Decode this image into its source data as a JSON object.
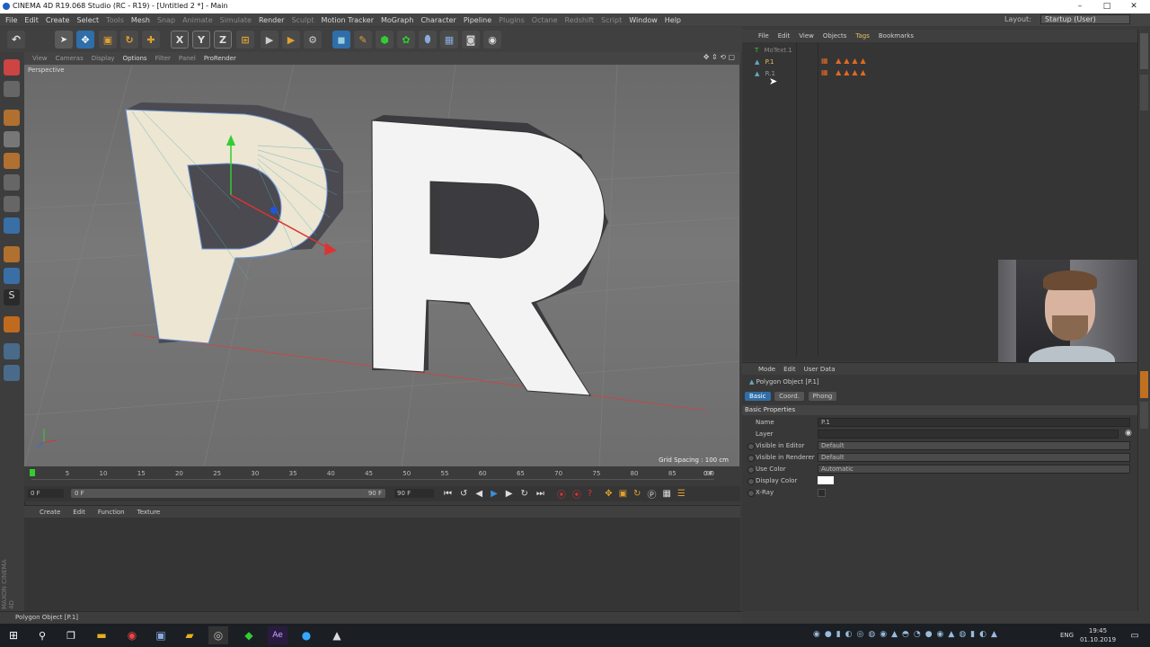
{
  "window": {
    "title": "CINEMA 4D R19.068 Studio (RC - R19) - [Untitled 2 *] - Main",
    "controls": [
      "–",
      "□",
      "✕"
    ]
  },
  "menubar": {
    "items": [
      {
        "label": "File",
        "dim": false
      },
      {
        "label": "Edit",
        "dim": false
      },
      {
        "label": "Create",
        "dim": false
      },
      {
        "label": "Select",
        "dim": false
      },
      {
        "label": "Tools",
        "dim": true
      },
      {
        "label": "Mesh",
        "dim": false
      },
      {
        "label": "Snap",
        "dim": true
      },
      {
        "label": "Animate",
        "dim": true
      },
      {
        "label": "Simulate",
        "dim": true
      },
      {
        "label": "Render",
        "dim": false
      },
      {
        "label": "Sculpt",
        "dim": true
      },
      {
        "label": "Motion Tracker",
        "dim": false
      },
      {
        "label": "MoGraph",
        "dim": false
      },
      {
        "label": "Character",
        "dim": false
      },
      {
        "label": "Pipeline",
        "dim": false
      },
      {
        "label": "Plugins",
        "dim": true
      },
      {
        "label": "Octane",
        "dim": true
      },
      {
        "label": "Redshift",
        "dim": true
      },
      {
        "label": "Script",
        "dim": true
      },
      {
        "label": "Window",
        "dim": false
      },
      {
        "label": "Help",
        "dim": false
      }
    ],
    "layout_label": "Layout:",
    "layout_value": "Startup (User)"
  },
  "toolbar": {
    "axis_x": "X",
    "axis_y": "Y",
    "axis_z": "Z"
  },
  "viewport": {
    "menu": [
      {
        "label": "View",
        "on": false
      },
      {
        "label": "Cameras",
        "on": false
      },
      {
        "label": "Display",
        "on": false
      },
      {
        "label": "Options",
        "on": true
      },
      {
        "label": "Filter",
        "on": false
      },
      {
        "label": "Panel",
        "on": false
      },
      {
        "label": "ProRender",
        "on": true
      }
    ],
    "camera_label": "Perspective",
    "grid_spacing": "Grid Spacing : 100 cm",
    "letter_left": "P",
    "letter_right": "R"
  },
  "timeline": {
    "ticks": [
      "0",
      "5",
      "10",
      "15",
      "20",
      "25",
      "30",
      "35",
      "40",
      "45",
      "50",
      "55",
      "60",
      "65",
      "70",
      "75",
      "80",
      "85",
      "90"
    ],
    "end_frame": "0 F",
    "start_field": "0 F",
    "min_field": "0 F",
    "max_field": "90 F",
    "end_field": "90 F"
  },
  "material": {
    "menu": [
      "Create",
      "Edit",
      "Function",
      "Texture"
    ]
  },
  "object_manager": {
    "menu": [
      "File",
      "Edit",
      "View",
      "Objects",
      "Tags",
      "Bookmarks"
    ],
    "objects": [
      {
        "name": "MoText.1"
      },
      {
        "name": "P.1"
      },
      {
        "name": "R.1"
      }
    ]
  },
  "attribute_manager": {
    "menu": [
      "Mode",
      "Edit",
      "User Data"
    ],
    "object_title": "Polygon Object [P.1]",
    "tabs": [
      "Basic",
      "Coord.",
      "Phong"
    ],
    "section": "Basic Properties",
    "properties": [
      {
        "label": "Name",
        "value": "P.1"
      },
      {
        "label": "Layer",
        "value": ""
      },
      {
        "label": "Visible in Editor",
        "value": "Default"
      },
      {
        "label": "Visible in Renderer",
        "value": "Default"
      },
      {
        "label": "Use Color",
        "value": "Automatic"
      },
      {
        "label": "Display Color",
        "value": ""
      },
      {
        "label": "X-Ray",
        "value": ""
      }
    ]
  },
  "status": {
    "text": "Polygon Object [P.1]"
  },
  "taskbar": {
    "lang": "ENG",
    "time": "19:45",
    "date": "01.10.2019"
  },
  "brand": {
    "logo_text": "MAXON CINEMA 4D"
  },
  "colors": {
    "accent": "#f0a020",
    "viewport_bg": "#717171",
    "taskbar": "#1b1f24"
  }
}
